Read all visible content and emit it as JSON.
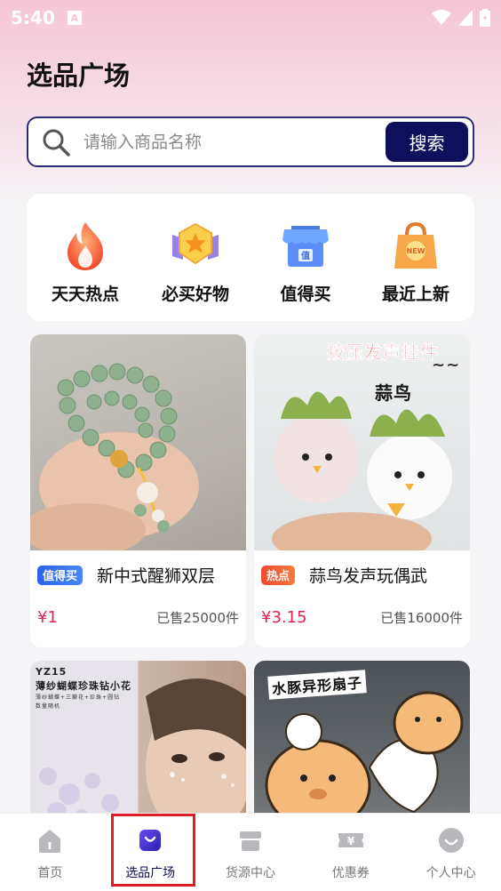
{
  "status": {
    "time": "5:40",
    "notif": "A"
  },
  "page": {
    "title": "选品广场"
  },
  "search": {
    "placeholder": "请输入商品名称",
    "button": "搜索"
  },
  "categories": [
    {
      "label": "天天热点",
      "icon": "flame-icon"
    },
    {
      "label": "必买好物",
      "icon": "star-badge-icon"
    },
    {
      "label": "值得买",
      "icon": "shop-icon",
      "badge": "值"
    },
    {
      "label": "最近上新",
      "icon": "new-bag-icon",
      "badge": "NEW"
    }
  ],
  "products": [
    {
      "tag": "值得买",
      "title": "新中式醒狮双层",
      "price": "¥1",
      "sold": "已售25000件"
    },
    {
      "tag": "热点",
      "title": "蒜鸟发声玩偶武",
      "price": "¥3.15",
      "sold": "已售16000件",
      "banner": "按压发声挂件",
      "sub": "蒜鸟",
      "wave": "~~"
    },
    {
      "code": "YZ15",
      "line1": "薄纱蝴蝶珍珠钻小花",
      "line2": "薄纱蝴蝶+三瓣花+珍珠+圆钻",
      "line3": "数量随机"
    },
    {
      "banner": "水豚异形扇子"
    }
  ],
  "tabs": [
    {
      "label": "首页",
      "icon": "home-icon"
    },
    {
      "label": "选品广场",
      "icon": "bag-icon"
    },
    {
      "label": "货源中心",
      "icon": "store-icon"
    },
    {
      "label": "优惠券",
      "icon": "coupon-icon",
      "glyph": "¥"
    },
    {
      "label": "个人中心",
      "icon": "profile-icon"
    }
  ],
  "colors": {
    "primary": "#0f0f5c",
    "price": "#e5234f",
    "highlight": "#e01b23"
  }
}
